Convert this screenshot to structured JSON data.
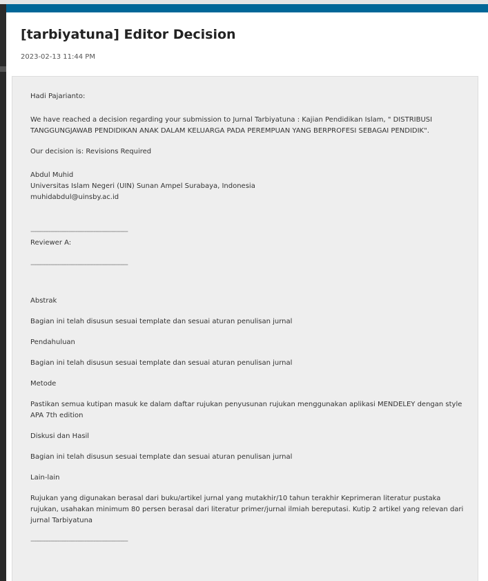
{
  "modal": {
    "title": "[tarbiyatuna] Editor Decision",
    "date": "2023-02-13 11:44 PM"
  },
  "message": {
    "salutation": "Hadi Pajarianto:",
    "intro": "We have reached a decision regarding your submission to Jurnal Tarbiyatuna : Kajian Pendidikan Islam, \" DISTRIBUSI TANGGUNGJAWAB PENDIDIKAN ANAK DALAM KELUARGA PADA PEREMPUAN YANG BERPROFESI SEBAGAI PENDIDIK\".",
    "decision": "Our decision is: Revisions Required",
    "editor_name": "Abdul Muhid",
    "editor_affiliation": "Universitas Islam Negeri (UIN) Sunan Ampel Surabaya, Indonesia",
    "editor_email": "muhidabdul@uinsby.ac.id",
    "separator": "------------------------------------------------------",
    "reviewer_label": "Reviewer A:",
    "sections": [
      {
        "heading": "Abstrak",
        "comment": "Bagian ini telah disusun sesuai template dan sesuai aturan penulisan jurnal"
      },
      {
        "heading": "Pendahuluan",
        "comment": "Bagian ini telah disusun sesuai template dan sesuai aturan penulisan jurnal"
      },
      {
        "heading": "Metode",
        "comment": "Pastikan semua kutipan masuk ke dalam daftar rujukan penyusunan rujukan menggunakan aplikasi MENDELEY dengan style APA 7th edition"
      },
      {
        "heading": "Diskusi dan Hasil",
        "comment": "Bagian ini telah disusun sesuai template dan sesuai aturan penulisan jurnal"
      },
      {
        "heading": "Lain-lain",
        "comment": "Rujukan yang digunakan berasal dari buku/artikel jurnal yang mutakhir/10 tahun terakhir Keprimeran literatur pustaka rujukan, usahakan minimum 80 persen berasal dari literatur primer/jurnal ilmiah bereputasi. Kutip 2 artikel yang relevan dari jurnal Tarbiyatuna"
      }
    ]
  },
  "colors": {
    "accent": "#006798",
    "panel_background": "#eeeeee",
    "backdrop": "#2b2b2b"
  }
}
